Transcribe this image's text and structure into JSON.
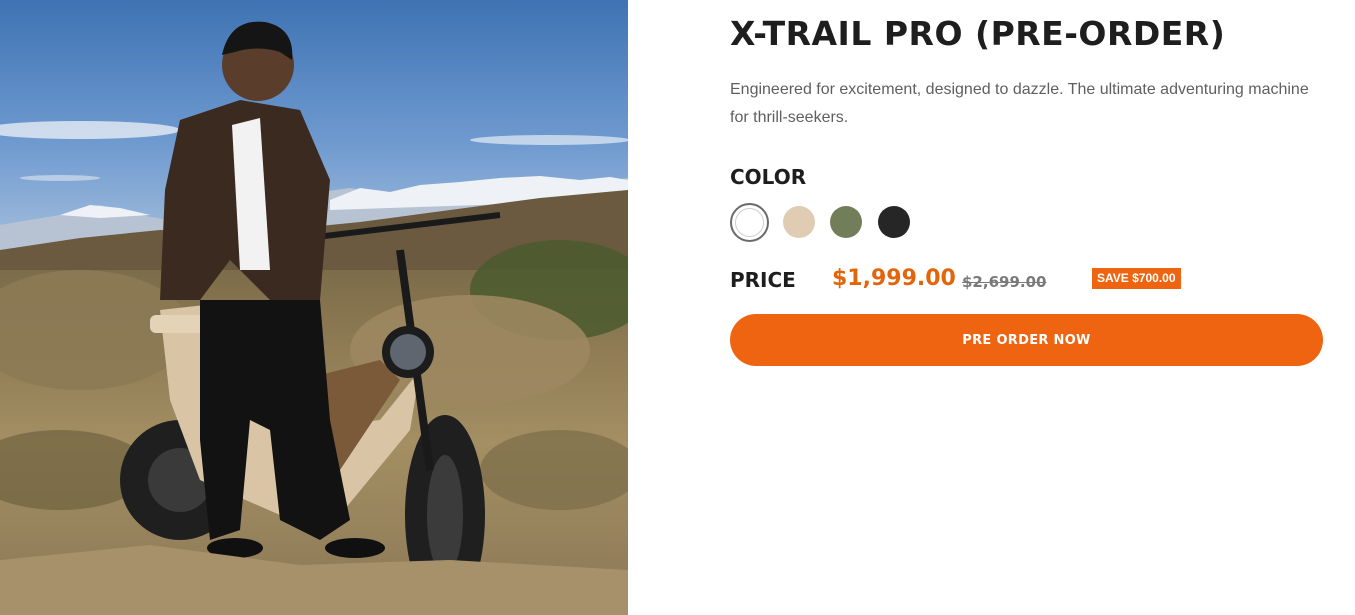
{
  "product": {
    "title": "X-TRAIL PRO (PRE-ORDER)",
    "description": "Engineered for excitement, designed to dazzle. The ultimate adventuring machine for thrill-seekers.",
    "image_alt": "Rider sitting on a tan electric moto-style bike in a desert landscape with snowy mountains"
  },
  "color": {
    "label": "COLOR",
    "selected_index": 0,
    "swatches": [
      {
        "name": "white-swatch",
        "hex": "#ffffff"
      },
      {
        "name": "sand-swatch",
        "hex": "#e0cbb3"
      },
      {
        "name": "olive-swatch",
        "hex": "#717e59"
      },
      {
        "name": "black-swatch",
        "hex": "#262626"
      }
    ]
  },
  "price": {
    "label": "PRICE",
    "current": "$1,999.00",
    "original": "$2,699.00",
    "save_badge": "SAVE $700.00"
  },
  "cta": {
    "label": "PRE ORDER NOW"
  },
  "colors": {
    "accent": "#ee6410",
    "price_text": "#e2650c"
  }
}
